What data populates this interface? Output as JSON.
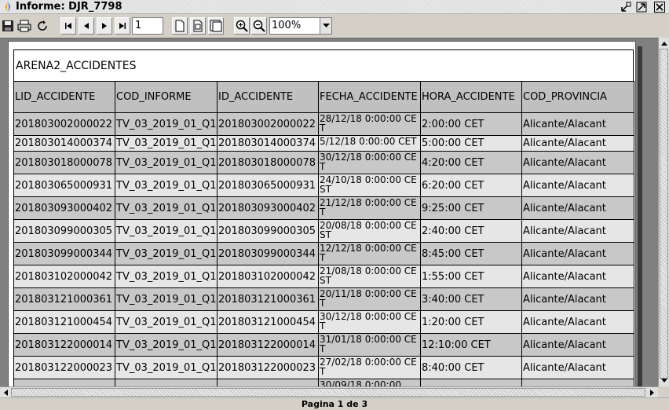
{
  "window": {
    "title": "Informe: DJR_7798"
  },
  "toolbar": {
    "page_number": "1",
    "zoom": "100%"
  },
  "report": {
    "title": "ARENA2_ACCIDENTES",
    "columns": [
      "LID_ACCIDENTE",
      "COD_INFORME",
      "ID_ACCIDENTE",
      "FECHA_ACCIDENTE",
      "HORA_ACCIDENTE",
      "COD_PROVINCIA"
    ],
    "rows": [
      [
        "201803002000022",
        "TV_03_2019_01_Q1",
        "201803002000022",
        "28/12/18 0:00:00 CET",
        "2:00:00 CET",
        "Alicante/Alacant"
      ],
      [
        "201803014000374",
        "TV_03_2019_01_Q1",
        "201803014000374",
        "5/12/18 0:00:00 CET",
        "5:00:00 CET",
        "Alicante/Alacant"
      ],
      [
        "201803018000078",
        "TV_03_2019_01_Q1",
        "201803018000078",
        "30/12/18 0:00:00 CET",
        "4:20:00 CET",
        "Alicante/Alacant"
      ],
      [
        "201803065000931",
        "TV_03_2019_01_Q1",
        "201803065000931",
        "24/10/18 0:00:00 CEST",
        "6:20:00 CET",
        "Alicante/Alacant"
      ],
      [
        "201803093000402",
        "TV_03_2019_01_Q1",
        "201803093000402",
        "21/12/18 0:00:00 CET",
        "9:25:00 CET",
        "Alicante/Alacant"
      ],
      [
        "201803099000305",
        "TV_03_2019_01_Q1",
        "201803099000305",
        "20/08/18 0:00:00 CEST",
        "2:40:00 CET",
        "Alicante/Alacant"
      ],
      [
        "201803099000344",
        "TV_03_2019_01_Q1",
        "201803099000344",
        "12/12/18 0:00:00 CET",
        "8:45:00 CET",
        "Alicante/Alacant"
      ],
      [
        "201803102000042",
        "TV_03_2019_01_Q1",
        "201803102000042",
        "21/08/18 0:00:00 CEST",
        "1:55:00 CET",
        "Alicante/Alacant"
      ],
      [
        "201803121000361",
        "TV_03_2019_01_Q1",
        "201803121000361",
        "20/11/18 0:00:00 CET",
        "3:40:00 CET",
        "Alicante/Alacant"
      ],
      [
        "201803121000454",
        "TV_03_2019_01_Q1",
        "201803121000454",
        "30/12/18 0:00:00 CET",
        "1:20:00 CET",
        "Alicante/Alacant"
      ],
      [
        "201803122000014",
        "TV_03_2019_01_Q1",
        "201803122000014",
        "31/01/18 0:00:00 CET",
        "12:10:00 CET",
        "Alicante/Alacant"
      ],
      [
        "201803122000023",
        "TV_03_2019_01_Q1",
        "201803122000023",
        "27/02/18 0:00:00 CET",
        "8:40:00 CET",
        "Alicante/Alacant"
      ],
      [
        "",
        "",
        "",
        "30/09/18 0:00:00",
        "",
        ""
      ]
    ]
  },
  "status": {
    "text": "Pagina 1 de 3"
  }
}
